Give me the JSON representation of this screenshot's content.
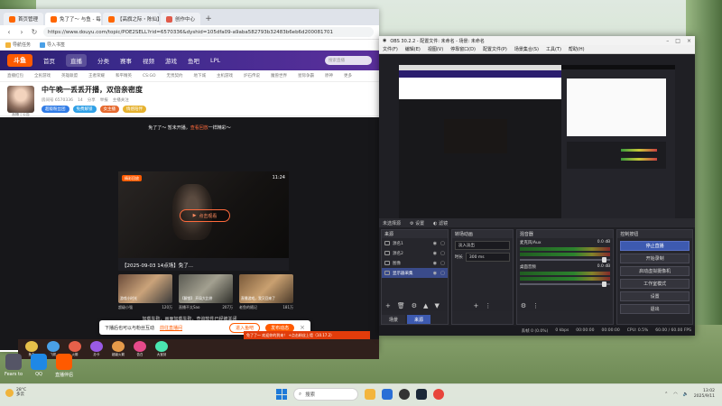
{
  "browser": {
    "tabs": [
      {
        "label": "首页管理"
      },
      {
        "label": "免了了～ 与鱼 - 每个人的直播平台"
      },
      {
        "label": "【高旗之际・陈仙】9月11日主页"
      },
      {
        "label": "创作中心"
      }
    ],
    "url": "https://www.douyu.com/topic/POE2SELL?rid=6570336&dyshid=105dfa09-a9aba582793b32483b6eb6d200081701",
    "bookmarks": [
      "导航任务",
      "导入书签"
    ]
  },
  "site": {
    "logo": "斗鱼",
    "nav": [
      "首页",
      "直播",
      "分类",
      "赛事",
      "视频",
      "游戏",
      "鱼吧",
      "LPL"
    ],
    "search_placeholder": "搜索直播",
    "subnav": [
      "直播红包",
      "全民游戏",
      "英雄联盟",
      "王者荣耀",
      "和平精英",
      "CS:GO",
      "无畏契约",
      "地下城",
      "主机游戏",
      "炉石传说",
      "魔兽世界",
      "星际争霸",
      "原神",
      "更多"
    ]
  },
  "room": {
    "avatar_caption": "直播 | 公告",
    "title": "中午晚一丢丢开播，双倍亲密度",
    "meta": [
      "房间号 6570336",
      "14",
      "分享",
      "举报"
    ],
    "tags": [
      "超级粉丝团",
      "免费解锁",
      "女主播",
      "情感陪伴"
    ],
    "stats": "主播关注"
  },
  "player": {
    "marquee_a": "免了了～ 暂未开播，",
    "marquee_link": "查看回放",
    "marquee_b": "一样精彩～",
    "badge": "精彩回放",
    "time": "11:24",
    "play_label": "点击观看",
    "caption": "【2025-09-03 14点场】免了...",
    "notice": "加载失败，画面加载失败，查询软件已经被关闭",
    "recs": [
      {
        "title": "游戏小时光",
        "viewer": "超级小强",
        "count": "120万"
      },
      {
        "title": "【解锁】 开局大比拼",
        "viewer": "直播不太Sao",
        "count": "207万"
      },
      {
        "title": "直播游戏，我又回来了",
        "viewer": "老鱼的随记",
        "count": "181万"
      }
    ]
  },
  "toast": {
    "text": "下播后也可以与粉丝互动",
    "link": "前往直播间",
    "btn_login": "进入鱼吧",
    "btn_fans": "发布动态"
  },
  "ticker": {
    "text": "免了了～ 欢迎你的到来！ +点击粉丝上墙（10.17.2）"
  },
  "gifts": [
    "鱼丸",
    "飞机",
    "火箭",
    "办卡",
    "超级火箭",
    "告白",
    "大宝剑"
  ],
  "obs": {
    "title": "OBS 30.2.2 - 配置文件: 未命名 - 场景: 未命名",
    "menu": [
      "文件(F)",
      "编辑(E)",
      "视图(V)",
      "停靠窗口(D)",
      "配置文件(P)",
      "场景集合(S)",
      "工具(T)",
      "帮助(H)"
    ],
    "scene_bar": [
      "未选择源",
      "设置",
      "滤镜"
    ],
    "docks": {
      "sources_title": "来源",
      "transitions_title": "转场动画",
      "mixer_title": "混音器",
      "controls_title": "控制按钮"
    },
    "sources": [
      {
        "name": "源名1"
      },
      {
        "name": "源名2"
      },
      {
        "name": "图像"
      },
      {
        "name": "显示器采集"
      }
    ],
    "scene_tabs": [
      "场景",
      "来源"
    ],
    "transition": {
      "type": "淡入淡出",
      "duration_label": "时长",
      "duration": "300 ms"
    },
    "mixer": [
      {
        "name": "麦克风/Aux",
        "db": "0.0 dB"
      },
      {
        "name": "桌面音频",
        "db": "0.0 dB"
      }
    ],
    "controls": [
      "停止直播",
      "开始录制",
      "启动虚拟摄像机",
      "工作室模式",
      "设置",
      "退出"
    ],
    "status": [
      "丢帧 0 (0.0%)",
      "0 kbps",
      "00:00:00",
      "00:00:00",
      "CPU: 0.5%",
      "60.00 / 60.00 FPS"
    ]
  },
  "desktop_icons": [
    "Fears to",
    "QQ",
    "直播伴侣"
  ],
  "taskbar": {
    "weather_temp": "28°C",
    "weather_text": "多云",
    "search": "搜索",
    "time": "13:02",
    "date": "2025/9/11"
  }
}
